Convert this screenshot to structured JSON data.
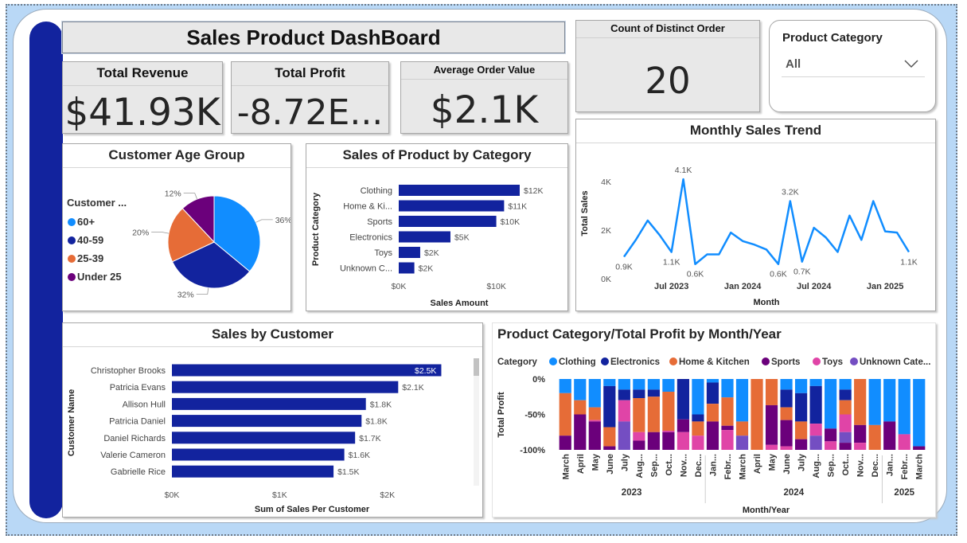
{
  "dashboard_title": "Sales Product DashBoard",
  "kpis": {
    "total_revenue": {
      "label": "Total Revenue",
      "value": "$41.93K"
    },
    "total_profit": {
      "label": "Total Profit",
      "value": "-8.72E..."
    },
    "avg_order_value": {
      "label": "Average Order Value",
      "value": "$2.1K"
    },
    "distinct_orders": {
      "label": "Count of Distinct Order",
      "value": "20"
    }
  },
  "filter": {
    "label": "Product Category",
    "selected": "All"
  },
  "colors": {
    "accent": "#12239e",
    "clothing": "#118dff",
    "electronics": "#12239e",
    "home": "#e66c37",
    "sports": "#6b007b",
    "toys": "#e044a7",
    "unknown": "#744ec2"
  },
  "chart_data": [
    {
      "id": "age",
      "type": "pie",
      "title": "Customer Age Group",
      "legend_title": "Customer ...",
      "legend_position": "left",
      "labels": [
        "60+",
        "40-59",
        "25-39",
        "Under 25"
      ],
      "values": [
        36,
        32,
        20,
        12
      ],
      "value_labels": [
        "36%",
        "32%",
        "20%",
        "12%"
      ],
      "colors": [
        "#118dff",
        "#12239e",
        "#e66c37",
        "#6b007b"
      ]
    },
    {
      "id": "category",
      "type": "bar",
      "orientation": "horizontal",
      "title": "Sales of Product by Category",
      "xlabel": "Sales Amount",
      "ylabel": "Product Category",
      "categories": [
        "Clothing",
        "Home & Ki...",
        "Sports",
        "Electronics",
        "Toys",
        "Unknown C..."
      ],
      "values": [
        12.4,
        10.8,
        10.0,
        5.3,
        2.2,
        1.6
      ],
      "data_labels": [
        "$12K",
        "$11K",
        "$10K",
        "$5K",
        "$2K",
        "$2K"
      ],
      "xlim": [
        0,
        12.4
      ],
      "xticks": [
        {
          "v": 0,
          "label": "$0K"
        },
        {
          "v": 10,
          "label": "$10K"
        }
      ]
    },
    {
      "id": "trend",
      "type": "line",
      "title": "Monthly Sales Trend",
      "xlabel": "Month",
      "ylabel": "Total Sales",
      "x": [
        "2023-03",
        "2023-04",
        "2023-05",
        "2023-06",
        "2023-07",
        "2023-08",
        "2023-09",
        "2023-10",
        "2023-11",
        "2023-12",
        "2024-01",
        "2024-02",
        "2024-03",
        "2024-04",
        "2024-05",
        "2024-06",
        "2024-07",
        "2024-08",
        "2024-09",
        "2024-10",
        "2024-11",
        "2024-12",
        "2025-01",
        "2025-02",
        "2025-03"
      ],
      "values": [
        0.9,
        1.6,
        2.4,
        1.8,
        1.1,
        4.1,
        0.6,
        1.0,
        1.0,
        1.9,
        1.55,
        1.4,
        1.2,
        0.6,
        3.2,
        0.7,
        2.1,
        1.7,
        1.1,
        2.6,
        1.6,
        3.2,
        1.95,
        1.9,
        1.1
      ],
      "point_labels": [
        {
          "i": 0,
          "text": "0.9K"
        },
        {
          "i": 4,
          "text": "1.1K"
        },
        {
          "i": 5,
          "text": "4.1K"
        },
        {
          "i": 6,
          "text": "0.6K"
        },
        {
          "i": 13,
          "text": "0.6K"
        },
        {
          "i": 14,
          "text": "3.2K"
        },
        {
          "i": 15,
          "text": "0.7K"
        },
        {
          "i": 24,
          "text": "1.1K"
        }
      ],
      "ylim": [
        0,
        4.4
      ],
      "yticks": [
        {
          "v": 0,
          "label": "0K"
        },
        {
          "v": 2,
          "label": "2K"
        },
        {
          "v": 4,
          "label": "4K"
        }
      ],
      "xticks": [
        {
          "i": 4,
          "label": "Jul 2023"
        },
        {
          "i": 10,
          "label": "Jan 2024"
        },
        {
          "i": 16,
          "label": "Jul 2024"
        },
        {
          "i": 22,
          "label": "Jan 2025"
        }
      ]
    },
    {
      "id": "customers",
      "type": "bar",
      "orientation": "horizontal",
      "title": "Sales by Customer",
      "xlabel": "Sum of Sales Per Customer",
      "ylabel": "Customer Name",
      "categories": [
        "Christopher Brooks",
        "Patricia Evans",
        "Allison Hull",
        "Patricia Daniel",
        "Daniel Richards",
        "Valerie Cameron",
        "Gabrielle Rice"
      ],
      "values": [
        2.5,
        2.1,
        1.8,
        1.76,
        1.7,
        1.6,
        1.5
      ],
      "data_labels": [
        "$2.5K",
        "$2.1K",
        "$1.8K",
        "$1.8K",
        "$1.7K",
        "$1.6K",
        "$1.5K"
      ],
      "xlim": [
        0,
        2.6
      ],
      "xticks": [
        {
          "v": 0,
          "label": "$0K"
        },
        {
          "v": 1,
          "label": "$1K"
        },
        {
          "v": 2,
          "label": "$2K"
        }
      ]
    },
    {
      "id": "profit",
      "type": "bar",
      "stacked": "100%",
      "title": "Product Category/Total Profit by Month/Year",
      "xlabel": "Month/Year",
      "ylabel": "Total Profit",
      "legend_title": "Category",
      "legend_position": "top",
      "series_names": [
        "Clothing",
        "Electronics",
        "Home & Kitchen",
        "Sports",
        "Toys",
        "Unknown Cate..."
      ],
      "series_colors": [
        "#118dff",
        "#12239e",
        "#e66c37",
        "#6b007b",
        "#e044a7",
        "#744ec2"
      ],
      "ylim": [
        -100,
        0
      ],
      "yticks": [
        {
          "v": 0,
          "label": "0%"
        },
        {
          "v": -50,
          "label": "-50%"
        },
        {
          "v": -100,
          "label": "-100%"
        }
      ],
      "groups": [
        {
          "label": "2023",
          "start": 0,
          "end": 9
        },
        {
          "label": "2024",
          "start": 10,
          "end": 21
        },
        {
          "label": "2025",
          "start": 22,
          "end": 24
        }
      ],
      "columns": [
        {
          "label": "March",
          "segments": [
            {
              "c": 0,
              "v": 20
            },
            {
              "c": 2,
              "v": 60
            },
            {
              "c": 3,
              "v": 20
            }
          ]
        },
        {
          "label": "April",
          "segments": [
            {
              "c": 0,
              "v": 30
            },
            {
              "c": 2,
              "v": 20
            },
            {
              "c": 3,
              "v": 50
            }
          ]
        },
        {
          "label": "May",
          "segments": [
            {
              "c": 0,
              "v": 40
            },
            {
              "c": 2,
              "v": 18
            },
            {
              "c": 4,
              "v": 2
            },
            {
              "c": 3,
              "v": 40
            }
          ]
        },
        {
          "label": "June",
          "segments": [
            {
              "c": 0,
              "v": 10
            },
            {
              "c": 1,
              "v": 58
            },
            {
              "c": 2,
              "v": 27
            },
            {
              "c": 3,
              "v": 5
            }
          ]
        },
        {
          "label": "July",
          "segments": [
            {
              "c": 0,
              "v": 15
            },
            {
              "c": 1,
              "v": 15
            },
            {
              "c": 4,
              "v": 30
            },
            {
              "c": 5,
              "v": 40
            }
          ]
        },
        {
          "label": "Aug...",
          "segments": [
            {
              "c": 0,
              "v": 15
            },
            {
              "c": 1,
              "v": 12
            },
            {
              "c": 2,
              "v": 48
            },
            {
              "c": 4,
              "v": 12
            },
            {
              "c": 3,
              "v": 13
            }
          ]
        },
        {
          "label": "Sep...",
          "segments": [
            {
              "c": 0,
              "v": 15
            },
            {
              "c": 1,
              "v": 10
            },
            {
              "c": 2,
              "v": 50
            },
            {
              "c": 3,
              "v": 25
            }
          ]
        },
        {
          "label": "Oct...",
          "segments": [
            {
              "c": 0,
              "v": 18
            },
            {
              "c": 2,
              "v": 55
            },
            {
              "c": 4,
              "v": 2
            },
            {
              "c": 3,
              "v": 25
            }
          ]
        },
        {
          "label": "Nov...",
          "segments": [
            {
              "c": 1,
              "v": 57
            },
            {
              "c": 3,
              "v": 18
            },
            {
              "c": 4,
              "v": 25
            }
          ]
        },
        {
          "label": "Dec...",
          "segments": [
            {
              "c": 0,
              "v": 50
            },
            {
              "c": 1,
              "v": 10
            },
            {
              "c": 2,
              "v": 20
            },
            {
              "c": 4,
              "v": 20
            }
          ]
        },
        {
          "label": "Jan...",
          "segments": [
            {
              "c": 0,
              "v": 5
            },
            {
              "c": 1,
              "v": 30
            },
            {
              "c": 2,
              "v": 25
            },
            {
              "c": 3,
              "v": 40
            }
          ]
        },
        {
          "label": "Febr...",
          "segments": [
            {
              "c": 0,
              "v": 26
            },
            {
              "c": 2,
              "v": 40
            },
            {
              "c": 3,
              "v": 6
            },
            {
              "c": 4,
              "v": 28
            }
          ]
        },
        {
          "label": "March",
          "segments": [
            {
              "c": 0,
              "v": 60
            },
            {
              "c": 2,
              "v": 20
            },
            {
              "c": 5,
              "v": 20
            }
          ]
        },
        {
          "label": "April",
          "segments": [
            {
              "c": 2,
              "v": 100
            }
          ]
        },
        {
          "label": "May",
          "segments": [
            {
              "c": 2,
              "v": 37
            },
            {
              "c": 3,
              "v": 56
            },
            {
              "c": 4,
              "v": 7
            }
          ]
        },
        {
          "label": "June",
          "segments": [
            {
              "c": 0,
              "v": 15
            },
            {
              "c": 1,
              "v": 25
            },
            {
              "c": 2,
              "v": 18
            },
            {
              "c": 3,
              "v": 37
            },
            {
              "c": 4,
              "v": 5
            }
          ]
        },
        {
          "label": "July",
          "segments": [
            {
              "c": 0,
              "v": 20
            },
            {
              "c": 1,
              "v": 40
            },
            {
              "c": 2,
              "v": 25
            },
            {
              "c": 3,
              "v": 15
            }
          ]
        },
        {
          "label": "Aug...",
          "segments": [
            {
              "c": 0,
              "v": 10
            },
            {
              "c": 1,
              "v": 53
            },
            {
              "c": 4,
              "v": 17
            },
            {
              "c": 5,
              "v": 20
            }
          ]
        },
        {
          "label": "Sep...",
          "segments": [
            {
              "c": 0,
              "v": 70
            },
            {
              "c": 3,
              "v": 18
            },
            {
              "c": 4,
              "v": 12
            }
          ]
        },
        {
          "label": "Oct...",
          "segments": [
            {
              "c": 0,
              "v": 15
            },
            {
              "c": 1,
              "v": 15
            },
            {
              "c": 2,
              "v": 20
            },
            {
              "c": 4,
              "v": 25
            },
            {
              "c": 5,
              "v": 15
            },
            {
              "c": 3,
              "v": 10
            }
          ]
        },
        {
          "label": "Nov...",
          "segments": [
            {
              "c": 2,
              "v": 65
            },
            {
              "c": 3,
              "v": 25
            },
            {
              "c": 4,
              "v": 10
            }
          ]
        },
        {
          "label": "Dec...",
          "segments": [
            {
              "c": 0,
              "v": 65
            },
            {
              "c": 2,
              "v": 35
            }
          ]
        },
        {
          "label": "Jan...",
          "segments": [
            {
              "c": 0,
              "v": 60
            },
            {
              "c": 3,
              "v": 40
            }
          ]
        },
        {
          "label": "Febr...",
          "segments": [
            {
              "c": 0,
              "v": 78
            },
            {
              "c": 4,
              "v": 22
            }
          ]
        },
        {
          "label": "March",
          "segments": [
            {
              "c": 0,
              "v": 95
            },
            {
              "c": 3,
              "v": 5
            }
          ]
        }
      ]
    }
  ]
}
